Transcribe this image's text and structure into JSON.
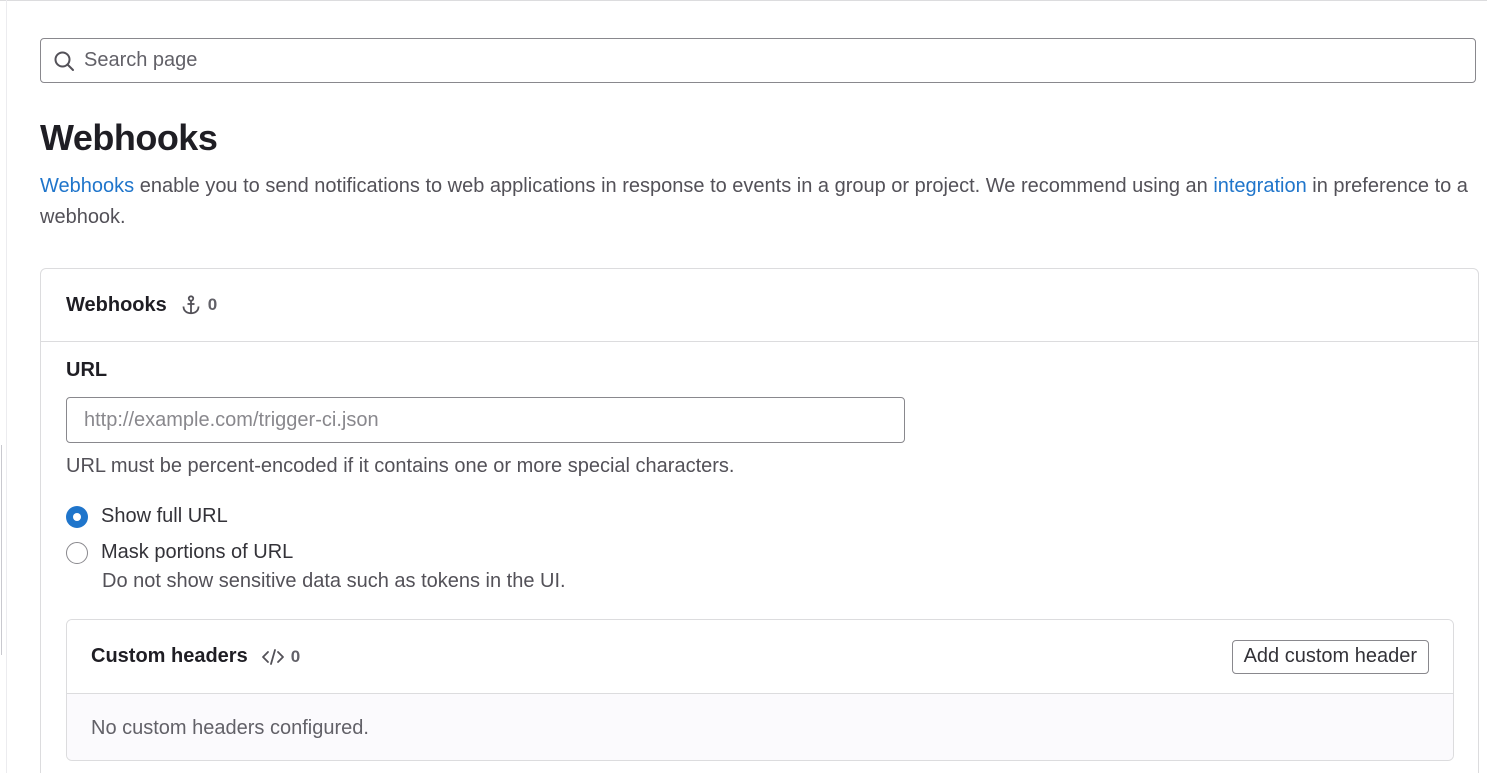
{
  "search": {
    "placeholder": "Search page"
  },
  "page": {
    "title": "Webhooks",
    "description": {
      "link1": "Webhooks",
      "text1": " enable you to send notifications to web applications in response to events in a group or project. We recommend using an ",
      "link2": "integration",
      "text2": " in preference to a webhook."
    }
  },
  "webhooks_card": {
    "title": "Webhooks",
    "count": "0",
    "icon": "anchor-icon"
  },
  "form": {
    "url_label": "URL",
    "url_placeholder": "http://example.com/trigger-ci.json",
    "url_help": "URL must be percent-encoded if it contains one or more special characters.",
    "radio_show_full": "Show full URL",
    "radio_mask": "Mask portions of URL",
    "radio_mask_help": "Do not show sensitive data such as tokens in the UI.",
    "selected": "show_full"
  },
  "custom_headers": {
    "title": "Custom headers",
    "count": "0",
    "icon": "code-icon",
    "add_button": "Add custom header",
    "empty_text": "No custom headers configured."
  },
  "colors": {
    "link": "#1f75cb",
    "radio_checked": "#1f75cb",
    "border": "#dcdcde"
  }
}
